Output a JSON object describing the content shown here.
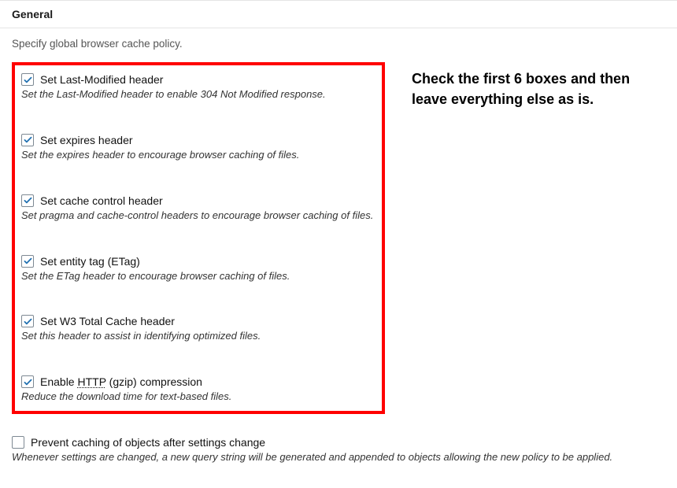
{
  "header": {
    "title": "General"
  },
  "subtitle": "Specify global browser cache policy.",
  "annotation": "Check the first 6 boxes and then leave everything else as is.",
  "options": {
    "last_modified": {
      "checked": true,
      "label": "Set Last-Modified header",
      "desc": "Set the Last-Modified header to enable 304 Not Modified response."
    },
    "expires": {
      "checked": true,
      "label": "Set expires header",
      "desc": "Set the expires header to encourage browser caching of files."
    },
    "cache_control": {
      "checked": true,
      "label": "Set cache control header",
      "desc": "Set pragma and cache-control headers to encourage browser caching of files."
    },
    "etag": {
      "checked": true,
      "label": "Set entity tag (ETag)",
      "desc": "Set the ETag header to encourage browser caching of files."
    },
    "w3tc": {
      "checked": true,
      "label": "Set W3 Total Cache header",
      "desc": "Set this header to assist in identifying optimized files."
    },
    "gzip": {
      "checked": true,
      "label_prefix": "Enable ",
      "label_dotted": "HTTP",
      "label_suffix": " (gzip) compression",
      "desc": "Reduce the download time for text-based files."
    },
    "prevent_caching": {
      "checked": false,
      "label": "Prevent caching of objects after settings change",
      "desc": "Whenever settings are changed, a new query string will be generated and appended to objects allowing the new policy to be applied."
    }
  }
}
